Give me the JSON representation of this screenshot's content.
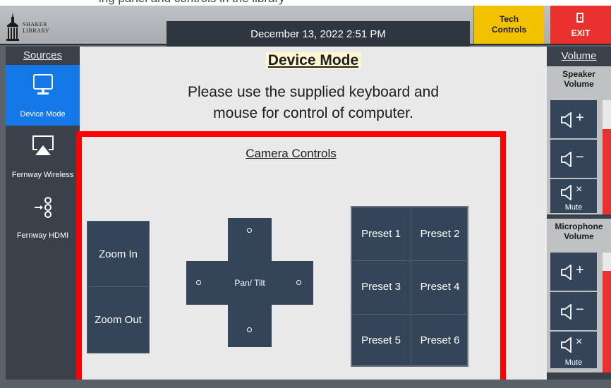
{
  "header": {
    "top_cropped_text": "ing panel and controls in the library",
    "logo_line1": "SHAKER",
    "logo_line2": "LIBRARY",
    "datetime": "December 13, 2022 2:51 PM",
    "tech_button": [
      "Tech",
      "Controls"
    ],
    "exit_label": "EXIT",
    "colors": {
      "tech": "#f2c200",
      "exit": "#e9312e"
    }
  },
  "sidebar": {
    "heading": "Sources",
    "items": [
      {
        "label": "Device Mode",
        "icon": "monitor-icon",
        "active": true
      },
      {
        "label": "Fernway Wireless",
        "icon": "airplay-icon",
        "active": false
      },
      {
        "label": "Fernway HDMI",
        "icon": "hdmi-input-icon",
        "active": false
      }
    ],
    "active_color": "#1478e8"
  },
  "main": {
    "title": "Device Mode",
    "message_line1": "Please use the supplied keyboard and",
    "message_line2": "mouse for control of computer.",
    "camera": {
      "title": "Camera Controls",
      "zoom_in": "Zoom In",
      "zoom_out": "Zoom Out",
      "pan_tilt": "Pan/ Tilt",
      "presets": [
        "Preset 1",
        "Preset 2",
        "Preset 3",
        "Preset 4",
        "Preset 5",
        "Preset 6"
      ]
    }
  },
  "volume": {
    "heading": "Volume",
    "speaker": {
      "title": [
        "Speaker",
        "Volume"
      ],
      "level": 0.75,
      "mute_label": "Mute"
    },
    "microphone": {
      "title": [
        "Microphone",
        "Volume"
      ],
      "level": 0.85,
      "mute_label": "Mute"
    }
  }
}
